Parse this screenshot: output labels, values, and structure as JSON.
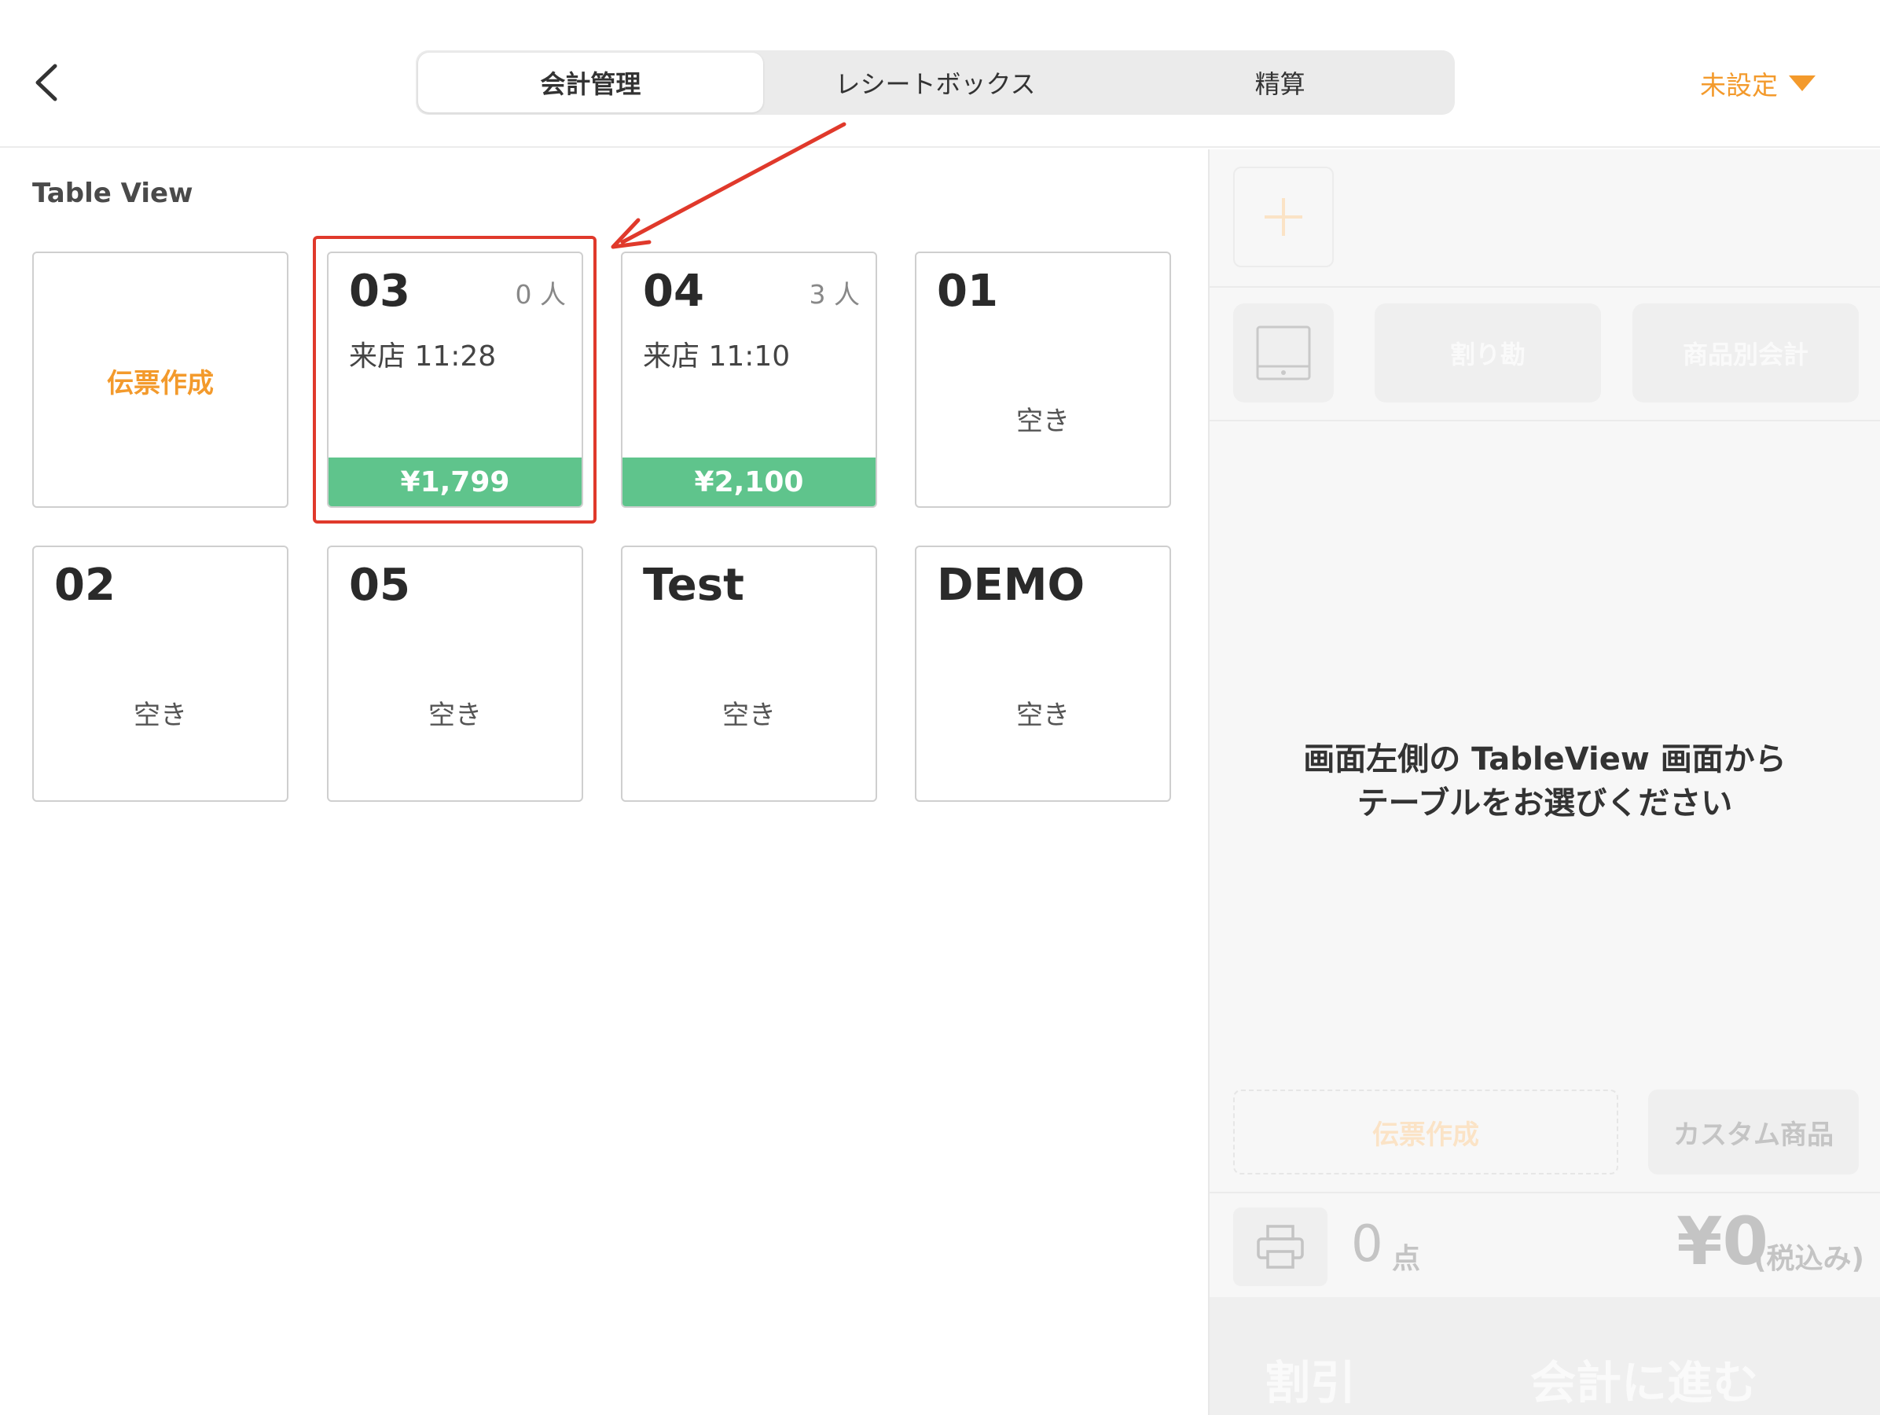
{
  "header": {
    "tabs": [
      {
        "label": "会計管理",
        "active": true
      },
      {
        "label": "レシートボックス",
        "active": false
      },
      {
        "label": "精算",
        "active": false
      }
    ],
    "store_selector": "未設定",
    "accent_color": "#f39a2c"
  },
  "table_view": {
    "title": "Table View",
    "create_label": "伝票作成",
    "tables": [
      {
        "name": "03",
        "guests": "0 人",
        "arrival": "来店 11:28",
        "amount": "¥1,799"
      },
      {
        "name": "04",
        "guests": "3 人",
        "arrival": "来店 11:10",
        "amount": "¥2,100"
      },
      {
        "name": "01",
        "status": "空き"
      },
      {
        "name": "02",
        "status": "空き"
      },
      {
        "name": "05",
        "status": "空き"
      },
      {
        "name": "Test",
        "status": "空き"
      },
      {
        "name": "DEMO",
        "status": "空き"
      }
    ],
    "occupied_color": "#5fc48c",
    "highlight_color": "#e0392b"
  },
  "right_panel": {
    "split_label": "割り勘",
    "item_checkout_label": "商品別会計",
    "hint_line1": "画面左側の TableView 画面から",
    "hint_line2": "テーブルをお選びください",
    "create_slip_label": "伝票作成",
    "custom_item_label": "カスタム商品",
    "item_count": "0",
    "item_count_unit": "点",
    "total": "¥0",
    "tax_note": "(税込み)",
    "discount_label": "割引",
    "proceed_label": "会計に進む"
  }
}
